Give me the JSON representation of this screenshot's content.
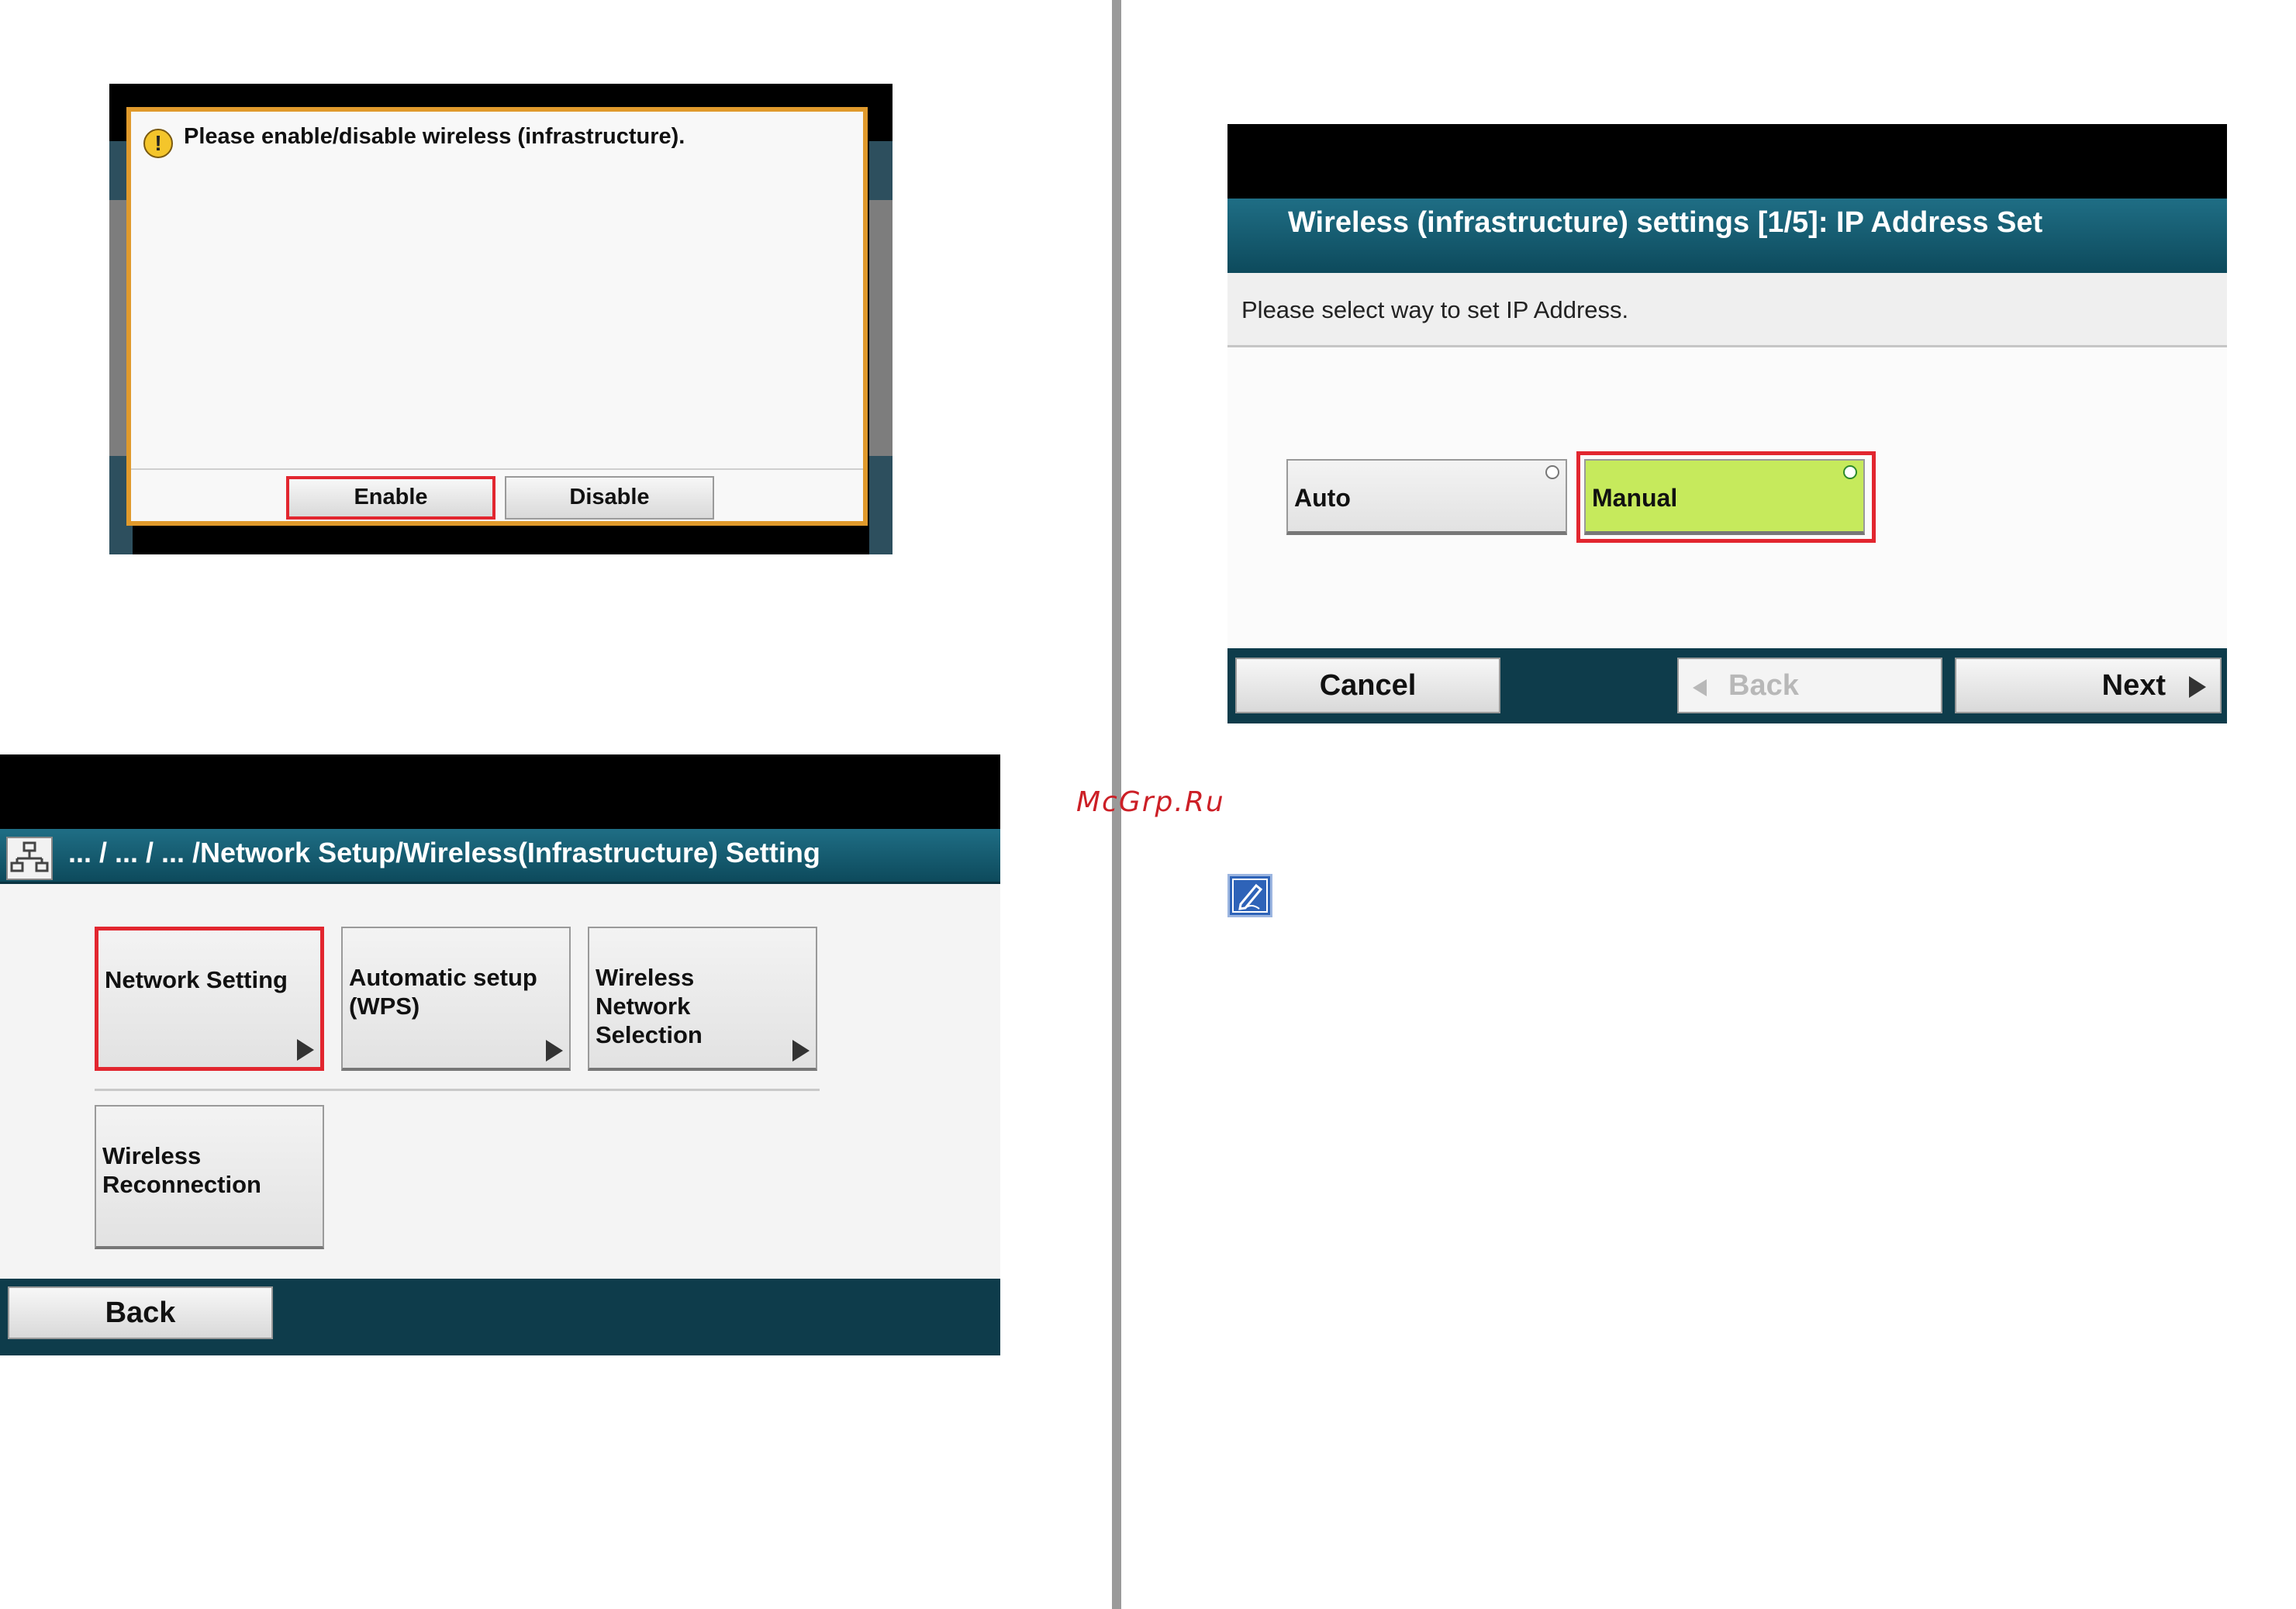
{
  "dialog_screen": {
    "message": "Please enable/disable wireless (infrastructure).",
    "icon": "warning-icon",
    "enable_label": "Enable",
    "disable_label": "Disable"
  },
  "network_screen": {
    "breadcrumb": "... / ... / ... /Network Setup/Wireless(Infrastructure) Setting",
    "icon": "network-icon",
    "tiles": [
      {
        "label": "Network Setting"
      },
      {
        "label": "Automatic setup\n(WPS)"
      },
      {
        "label": "Wireless\nNetwork\nSelection"
      },
      {
        "label": "Wireless\nReconnection"
      }
    ],
    "back_label": "Back"
  },
  "ip_screen": {
    "title": "Wireless (infrastructure) settings [1/5]: IP Address Set",
    "instruction": "Please select way to set IP Address.",
    "options": [
      {
        "label": "Auto",
        "selected": false
      },
      {
        "label": "Manual",
        "selected": true
      }
    ],
    "cancel_label": "Cancel",
    "back_label": "Back",
    "next_label": "Next"
  },
  "watermark": "McGrp.Ru",
  "note_icon": "pencil-note-icon",
  "colors": {
    "highlight": "#e2262f",
    "header_teal": "#1f6e85",
    "footer_teal": "#0e3c4b",
    "selected_green": "#c6ea5c",
    "dialog_border": "#e09a2c"
  }
}
